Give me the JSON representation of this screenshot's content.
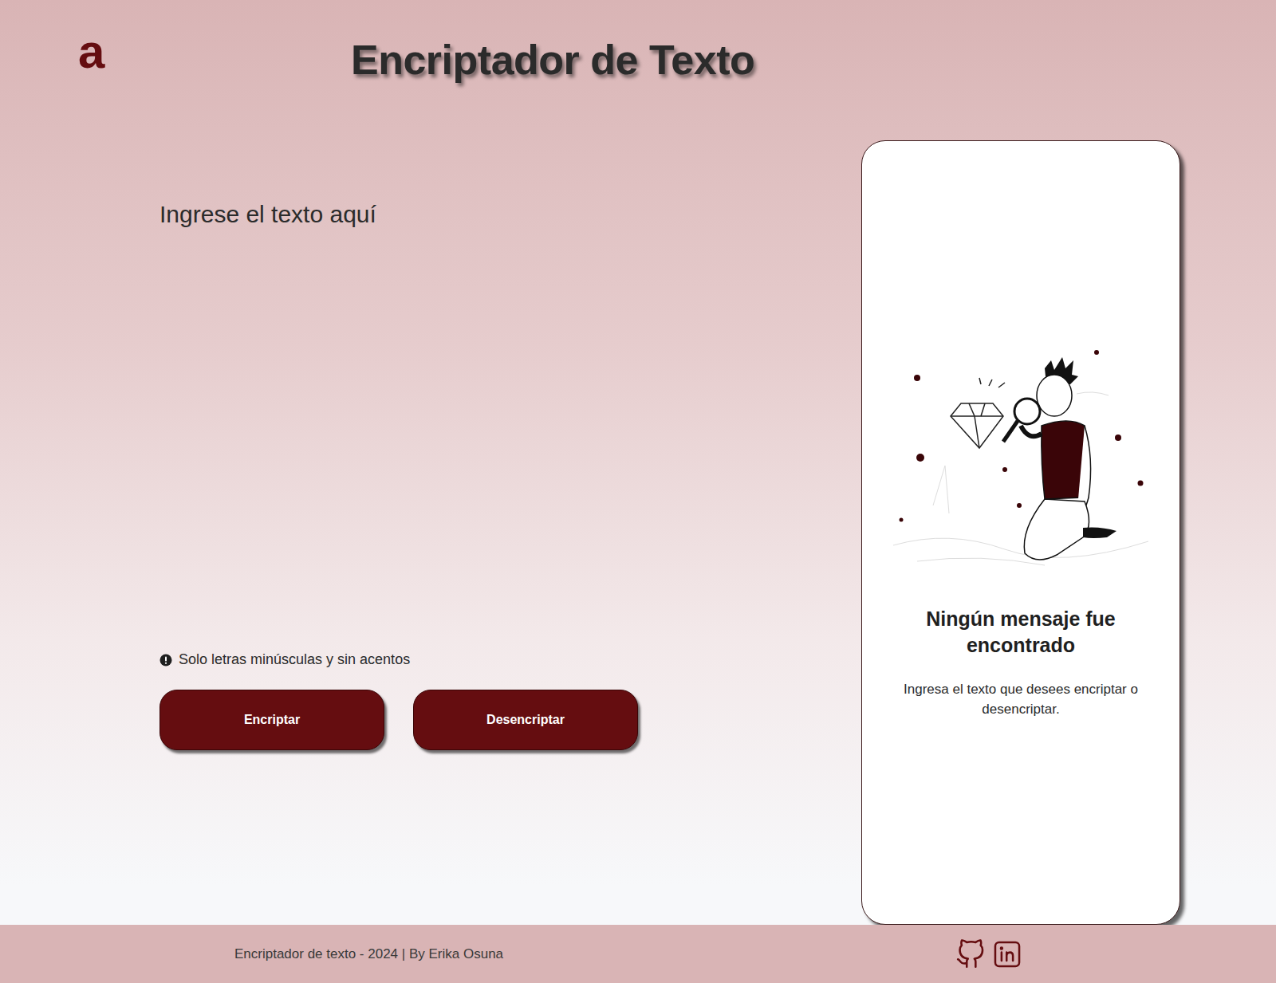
{
  "header": {
    "logo": "a",
    "title": "Encriptador de Texto"
  },
  "input": {
    "placeholder": "Ingrese el texto aquí"
  },
  "notice": "Solo letras minúsculas y sin acentos",
  "buttons": [
    "Encriptar",
    "Desencriptar"
  ],
  "output": {
    "heading": "Ningún mensaje fue encontrado",
    "message": "Ingresa el texto que desees encriptar o desencriptar."
  },
  "footer": {
    "credit": "Encriptador de texto - 2024 | By Erika Osuna"
  }
}
